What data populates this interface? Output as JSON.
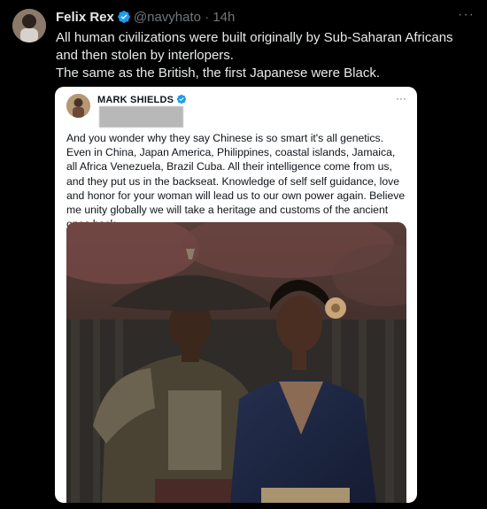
{
  "tweet": {
    "author_name": "Felix Rex",
    "author_handle": "@navyhato",
    "separator": "·",
    "timestamp": "14h",
    "more_label": "···",
    "lines": [
      "All human civilizations were built originally by Sub-Saharan Africans and then stolen by interlopers.",
      "The same as the British, the first Japanese were Black."
    ]
  },
  "quoted": {
    "author_name": "MARK SHIELDS",
    "more_label": "···",
    "text": "And you wonder why they say Chinese is so smart it's all genetics. Even in China, Japan America, Philippines, coastal islands, Jamaica, all Africa Venezuela, Brazil Cuba. All their intelligence come from us, and they put us in the backseat. Knowledge of self self guidance, love and honor for your woman will lead us to our own power again. Believe me unity globally we will take a heritage and customs of the ancient ones back."
  },
  "colors": {
    "background": "#000000",
    "verified_badge": "#1d9bf0",
    "muted_text": "#71767b",
    "embed_background": "#ffffff"
  },
  "icons": [
    "avatar",
    "verified-badge-icon",
    "more-options-icon",
    "embedded-image"
  ]
}
